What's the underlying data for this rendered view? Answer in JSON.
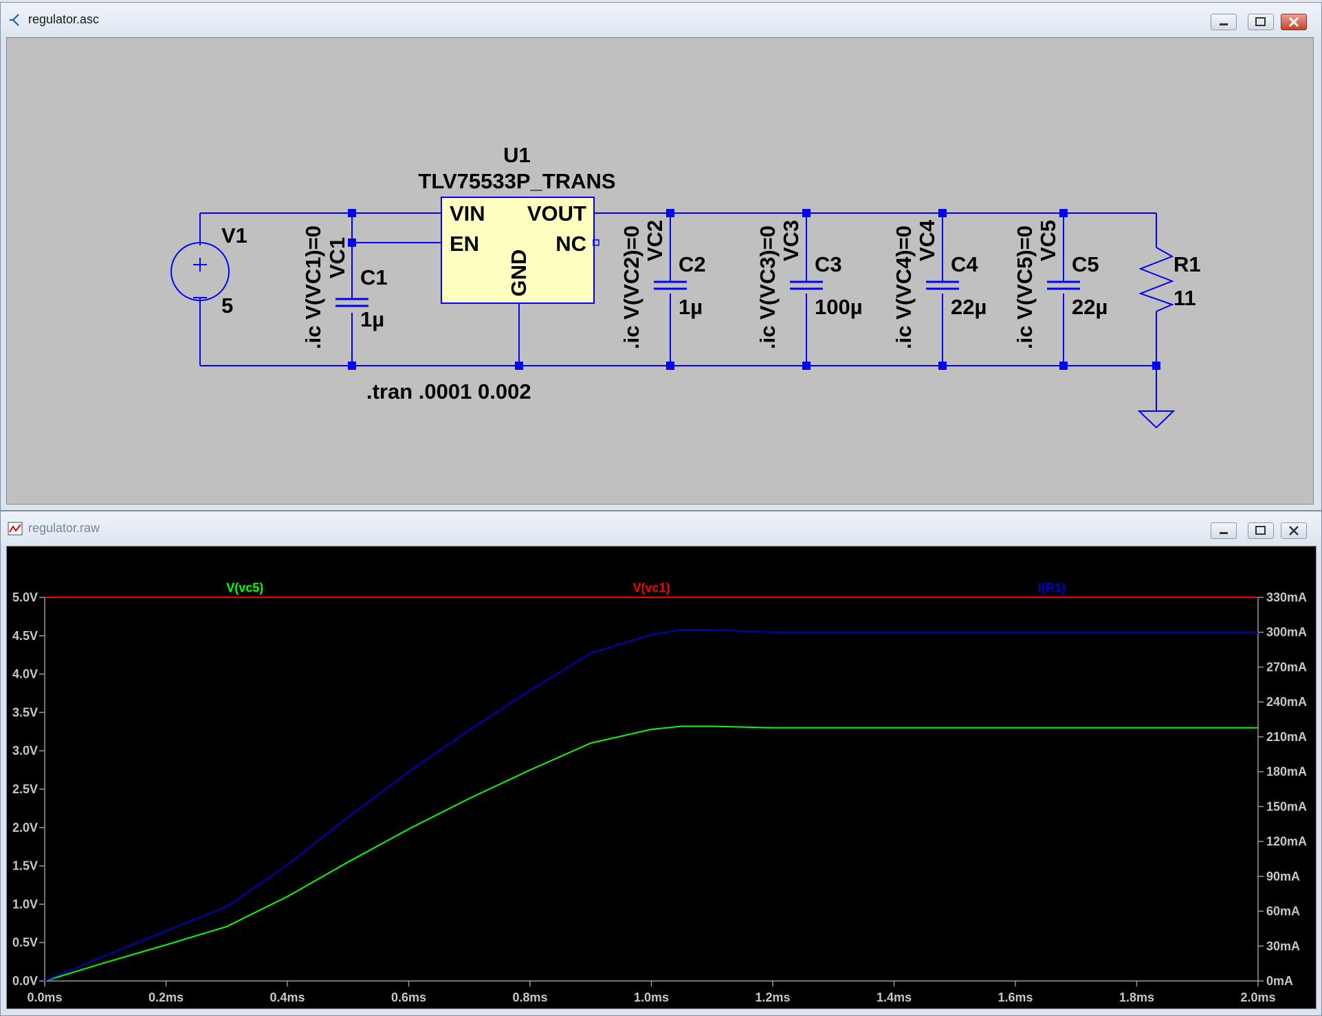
{
  "schematic_window": {
    "title": "regulator.asc",
    "components": {
      "u1_name": "U1",
      "u1_part": "TLV75533P_TRANS",
      "pin_vin": "VIN",
      "pin_vout": "VOUT",
      "pin_en": "EN",
      "pin_nc": "NC",
      "pin_gnd": "GND",
      "v1_name": "V1",
      "v1_value": "5",
      "c1_name": "C1",
      "c1_value": "1µ",
      "c1_net": "VC1",
      "c1_ic": ".ic V(VC1)=0",
      "c2_name": "C2",
      "c2_value": "1µ",
      "c2_net": "VC2",
      "c2_ic": ".ic V(VC2)=0",
      "c3_name": "C3",
      "c3_value": "100µ",
      "c3_net": "VC3",
      "c3_ic": ".ic V(VC3)=0",
      "c4_name": "C4",
      "c4_value": "22µ",
      "c4_net": "VC4",
      "c4_ic": ".ic V(VC4)=0",
      "c5_name": "C5",
      "c5_value": "22µ",
      "c5_net": "VC5",
      "c5_ic": ".ic V(VC5)=0",
      "r1_name": "R1",
      "r1_value": "11",
      "directive": ".tran .0001 0.002"
    }
  },
  "waveform_window": {
    "title": "regulator.raw"
  },
  "colors": {
    "wire": "#0000ff",
    "canvas": "#c0c0c0",
    "ic_fill": "#ffffc0",
    "trace_vc5": "#00ff00",
    "trace_vc1": "#ff0000",
    "trace_ir1": "#0000c8",
    "axis_text": "#c8c8c8"
  },
  "chart_data": {
    "type": "line",
    "x": [
      0,
      0.1,
      0.2,
      0.3,
      0.4,
      0.5,
      0.6,
      0.7,
      0.8,
      0.9,
      1.0,
      1.05,
      1.1,
      1.2,
      1.4,
      1.6,
      1.8,
      2.0
    ],
    "xlabel_unit": "ms",
    "xlim": [
      0,
      2.0
    ],
    "x_ticks": [
      "0.0ms",
      "0.2ms",
      "0.4ms",
      "0.6ms",
      "0.8ms",
      "1.0ms",
      "1.2ms",
      "1.4ms",
      "1.6ms",
      "1.8ms",
      "2.0ms"
    ],
    "ylim_left": [
      0,
      5.0
    ],
    "y_ticks_left": [
      "0.0V",
      "0.5V",
      "1.0V",
      "1.5V",
      "2.0V",
      "2.5V",
      "3.0V",
      "3.5V",
      "4.0V",
      "4.5V",
      "5.0V"
    ],
    "ylim_right": [
      0,
      330
    ],
    "y_ticks_right": [
      "0mA",
      "30mA",
      "60mA",
      "90mA",
      "120mA",
      "150mA",
      "180mA",
      "210mA",
      "240mA",
      "270mA",
      "300mA",
      "330mA"
    ],
    "series": [
      {
        "name": "V(vc5)",
        "axis": "left",
        "values": [
          0,
          0.24,
          0.47,
          0.71,
          1.1,
          1.55,
          1.98,
          2.38,
          2.75,
          3.1,
          3.28,
          3.32,
          3.32,
          3.3,
          3.3,
          3.3,
          3.3,
          3.3
        ]
      },
      {
        "name": "V(vc1)",
        "axis": "left",
        "values": [
          5.0,
          5.0,
          5.0,
          5.0,
          5.0,
          5.0,
          5.0,
          5.0,
          5.0,
          5.0,
          5.0,
          5.0,
          5.0,
          5.0,
          5.0,
          5.0,
          5.0,
          5.0
        ]
      },
      {
        "name": "I(R1)",
        "axis": "right",
        "values": [
          0,
          22,
          43,
          64,
          100,
          141,
          180,
          216,
          250,
          282,
          298,
          302,
          302,
          300,
          300,
          300,
          300,
          300
        ]
      }
    ],
    "grid": false,
    "legend": "top"
  }
}
